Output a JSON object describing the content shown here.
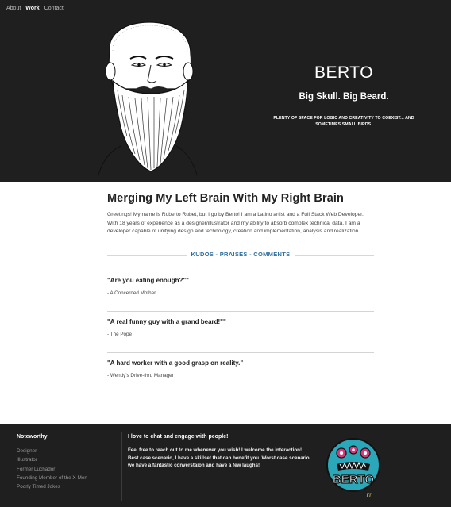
{
  "nav": {
    "items": [
      {
        "label": "About",
        "active": false
      },
      {
        "label": "Work",
        "active": true
      },
      {
        "label": "Contact",
        "active": false
      }
    ]
  },
  "hero": {
    "name": "BERTO",
    "tagline": "Big Skull. Big Beard.",
    "subtitle": "PLENTY OF SPACE FOR LOGIC AND CREATIVITY TO COEXIST... AND SOMETIMES SMALL BIRDS.",
    "portrait_icon": "bearded-man-portrait"
  },
  "main": {
    "title": "Merging My Left Brain With My Right Brain",
    "intro": "Greetings! My name is Roberto Rubet, but I go by Berto! I am a Latino artist and a Full Stack Web Developer. With 18 years of experience as a designer/illustrator and my ability to absorb complex technical data, I am a developer capable of unifying design and technology, creation and implementation, analysis and realization.",
    "kudos_label": "KUDOS - PRAISES - COMMENTS",
    "quotes": [
      {
        "text": "\"Are you eating enough?\"\"",
        "author": "- A Concerned Mother"
      },
      {
        "text": "\"A real funny guy with a grand beard!\"\"",
        "author": "- The Pope"
      },
      {
        "text": "\"A hard worker with a good grasp on reality.\"",
        "author": "- Wendy's Drive-thru Manager"
      }
    ]
  },
  "footer": {
    "noteworthy_title": "Noteworthy",
    "noteworthy_items": [
      "Designer",
      "Illustrator",
      "Former Luchador",
      "Founding Member of the X-Men",
      "Poorly Timed Jokes"
    ],
    "chat_title": "I love to chat and engage with people!",
    "chat_body": "Feel free to reach out to me whenever you wish! I welcome the interaction! Best case scenario, I have a skillset that can benefit you. Worst case scenario, we have a fantastic converstaion and have a few laughs!",
    "badge_text": "BERTO",
    "badge_sub": "rr",
    "badge_icon": "monster-logo"
  },
  "colors": {
    "dark_bg": "#1f1f1f",
    "accent_blue": "#2f6f9f",
    "badge_teal": "#2aa7b8",
    "badge_pink": "#d8387a"
  }
}
